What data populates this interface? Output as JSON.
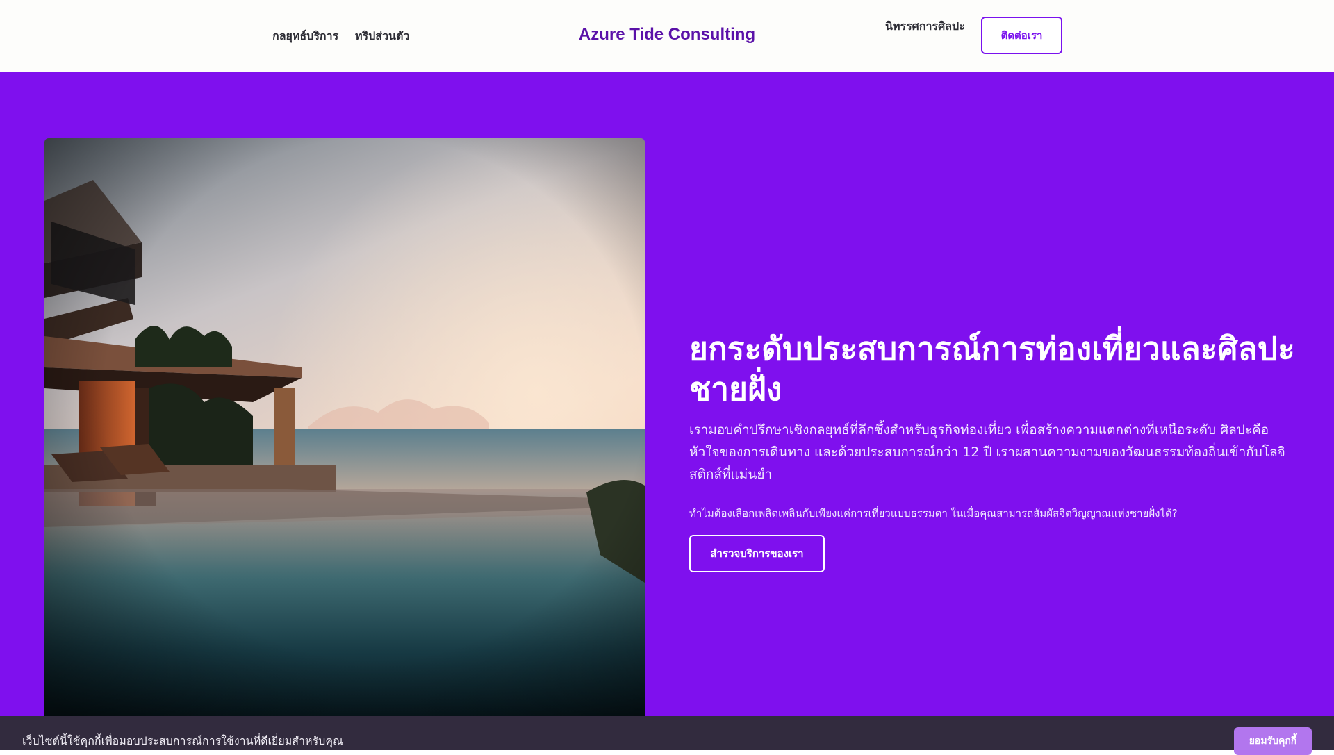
{
  "header": {
    "brand": "Azure Tide Consulting",
    "nav_left": [
      "กลยุทธ์บริการ",
      "ทริปส่วนตัว"
    ],
    "nav_right": [
      "นิทรรศการศิลปะ"
    ],
    "contact_label": "ติดต่อเรา"
  },
  "hero": {
    "title": "ยกระดับประสบการณ์การท่องเที่ยวและศิลปะชายฝั่ง",
    "description": "เรามอบคำปรึกษาเชิงกลยุทธ์ที่ลึกซึ้งสำหรับธุรกิจท่องเที่ยว เพื่อสร้างความแตกต่างที่เหนือระดับ ศิลปะคือหัวใจของการเดินทาง และด้วยประสบการณ์กว่า 12 ปี เราผสานความงามของวัฒนธรรมท้องถิ่นเข้ากับโลจิสติกส์ที่แม่นยำ",
    "question": "ทำไมต้องเลือกเพลิดเพลินกับเพียงแค่การเที่ยวแบบธรรมดา ในเมื่อคุณสามารถสัมผัสจิตวิญญาณแห่งชายฝั่งได้?",
    "cta_label": "สำรวจบริการของเรา"
  },
  "cookie": {
    "text": "เว็บไซต์นี้ใช้คุกกี้เพื่อมอบประสบการณ์การใช้งานที่ดีเยี่ยมสำหรับคุณ",
    "accept_label": "ยอมรับคุกกี้"
  },
  "colors": {
    "hero_background": "#7f10ee",
    "brand": "#5a11a8",
    "accent": "#7a12ee",
    "cookie_bar": "#322b3e",
    "cookie_button": "#b276ee"
  }
}
